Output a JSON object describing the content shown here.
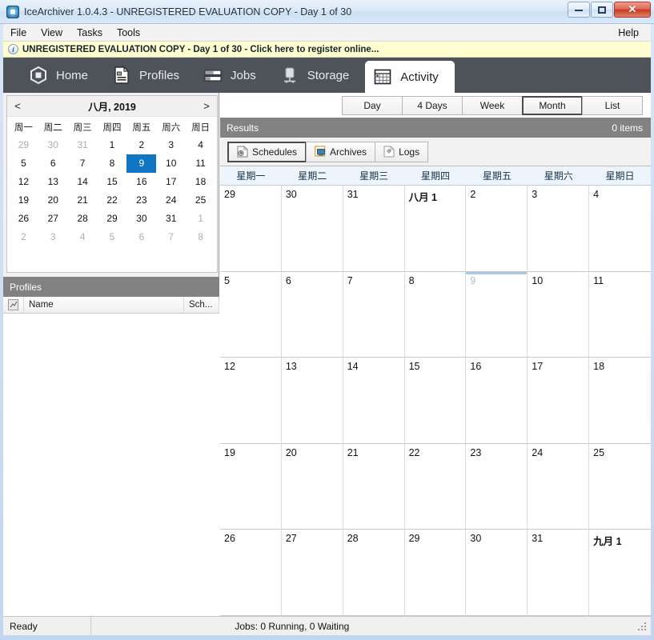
{
  "window": {
    "title": "IceArchiver 1.0.4.3 - UNREGISTERED EVALUATION COPY - Day 1 of 30",
    "icon": "app-icon",
    "minimize_label": "Minimize",
    "maximize_label": "Maximize",
    "close_label": "✕"
  },
  "menubar": {
    "items": [
      {
        "label": "File"
      },
      {
        "label": "View"
      },
      {
        "label": "Tasks"
      },
      {
        "label": "Tools"
      }
    ],
    "help_label": "Help"
  },
  "nagbar": {
    "icon": "info-icon",
    "icon_glyph": "i",
    "text": "UNREGISTERED EVALUATION COPY - Day 1 of 30 - Click here to register online...",
    "background": "#ffffd0"
  },
  "ribbon": {
    "background": "#4e5359",
    "tabs": [
      {
        "label": "Home",
        "icon": "home-hexagon-icon",
        "active": false
      },
      {
        "label": "Profiles",
        "icon": "profiles-document-icon",
        "active": false
      },
      {
        "label": "Jobs",
        "icon": "jobs-bars-icon",
        "active": false
      },
      {
        "label": "Storage",
        "icon": "storage-drive-icon",
        "active": false
      },
      {
        "label": "Activity",
        "icon": "activity-calendar-icon",
        "active": true
      }
    ]
  },
  "sidebar": {
    "mini_calendar": {
      "prev_label": "<",
      "next_label": ">",
      "title": "八月, 2019",
      "day_headers": [
        "周一",
        "周二",
        "周三",
        "周四",
        "周五",
        "周六",
        "周日"
      ],
      "selected_day": 9,
      "weeks": [
        [
          {
            "d": "29",
            "dim": true
          },
          {
            "d": "30",
            "dim": true
          },
          {
            "d": "31",
            "dim": true
          },
          {
            "d": "1"
          },
          {
            "d": "2"
          },
          {
            "d": "3"
          },
          {
            "d": "4"
          }
        ],
        [
          {
            "d": "5"
          },
          {
            "d": "6"
          },
          {
            "d": "7"
          },
          {
            "d": "8"
          },
          {
            "d": "9",
            "sel": true
          },
          {
            "d": "10"
          },
          {
            "d": "11"
          }
        ],
        [
          {
            "d": "12"
          },
          {
            "d": "13"
          },
          {
            "d": "14"
          },
          {
            "d": "15"
          },
          {
            "d": "16"
          },
          {
            "d": "17"
          },
          {
            "d": "18"
          }
        ],
        [
          {
            "d": "19"
          },
          {
            "d": "20"
          },
          {
            "d": "21"
          },
          {
            "d": "22"
          },
          {
            "d": "23"
          },
          {
            "d": "24"
          },
          {
            "d": "25"
          }
        ],
        [
          {
            "d": "26"
          },
          {
            "d": "27"
          },
          {
            "d": "28"
          },
          {
            "d": "29"
          },
          {
            "d": "30"
          },
          {
            "d": "31"
          },
          {
            "d": "1",
            "dim": true
          }
        ],
        [
          {
            "d": "2",
            "dim": true
          },
          {
            "d": "3",
            "dim": true
          },
          {
            "d": "4",
            "dim": true
          },
          {
            "d": "5",
            "dim": true
          },
          {
            "d": "6",
            "dim": true
          },
          {
            "d": "7",
            "dim": true
          },
          {
            "d": "8",
            "dim": true
          }
        ]
      ]
    },
    "profiles": {
      "header": "Profiles",
      "columns": [
        "",
        "Name",
        "Sch..."
      ],
      "rows": []
    }
  },
  "main": {
    "view_buttons": [
      {
        "label": "Day",
        "active": false
      },
      {
        "label": "4 Days",
        "active": false
      },
      {
        "label": "Week",
        "active": false
      },
      {
        "label": "Month",
        "active": true
      },
      {
        "label": "List",
        "active": false
      }
    ],
    "results": {
      "title": "Results",
      "count_text": "0 items"
    },
    "segments": [
      {
        "label": "Schedules",
        "icon": "schedules-clock-doc-icon",
        "active": true
      },
      {
        "label": "Archives",
        "icon": "archives-box-icon",
        "active": false
      },
      {
        "label": "Logs",
        "icon": "logs-gear-doc-icon",
        "active": false
      }
    ],
    "calendar": {
      "day_headers": [
        "星期一",
        "星期二",
        "星期三",
        "星期四",
        "星期五",
        "星期六",
        "星期日"
      ],
      "today_label": "9",
      "cells": [
        {
          "label": "29"
        },
        {
          "label": "30"
        },
        {
          "label": "31"
        },
        {
          "label": "八月 1",
          "bold": true
        },
        {
          "label": "2"
        },
        {
          "label": "3"
        },
        {
          "label": "4"
        },
        {
          "label": "5"
        },
        {
          "label": "6"
        },
        {
          "label": "7"
        },
        {
          "label": "8"
        },
        {
          "label": "9",
          "today": true
        },
        {
          "label": "10"
        },
        {
          "label": "11"
        },
        {
          "label": "12"
        },
        {
          "label": "13"
        },
        {
          "label": "14"
        },
        {
          "label": "15"
        },
        {
          "label": "16"
        },
        {
          "label": "17"
        },
        {
          "label": "18"
        },
        {
          "label": "19"
        },
        {
          "label": "20"
        },
        {
          "label": "21"
        },
        {
          "label": "22"
        },
        {
          "label": "23"
        },
        {
          "label": "24"
        },
        {
          "label": "25"
        },
        {
          "label": "26"
        },
        {
          "label": "27"
        },
        {
          "label": "28"
        },
        {
          "label": "29"
        },
        {
          "label": "30"
        },
        {
          "label": "31"
        },
        {
          "label": "九月 1",
          "bold": true
        }
      ]
    }
  },
  "statusbar": {
    "ready_text": "Ready",
    "jobs_text": "Jobs: 0 Running, 0 Waiting"
  },
  "colors": {
    "ribbon_bg": "#4e5359",
    "header_bar": "#828282",
    "selection_blue": "#1076c4",
    "today_blue": "#a8cbe8",
    "nag_yellow": "#ffffd0"
  }
}
